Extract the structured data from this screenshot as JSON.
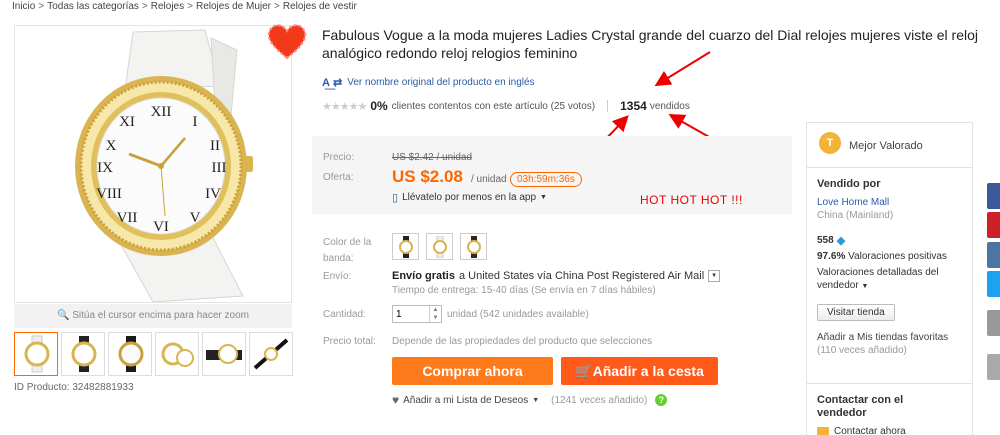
{
  "breadcrumb": [
    "Inicio",
    "Todas las categorías",
    "Relojes",
    "Relojes de Mujer",
    "Relojes de vestir"
  ],
  "zoom_hint": "Sitúa el cursor encima para hacer zoom",
  "product_id": "ID Producto: 32482881933",
  "title": "Fabulous Vogue a la moda mujeres Ladies Crystal grande del cuarzo del Dial relojes mujeres viste el reloj analógico redondo reloj relogios feminino",
  "translate_link": "Ver nombre original del producto en inglés",
  "rating": {
    "percent": "0%",
    "text": "clientes contentos con este artículo (25 votos)",
    "sold_count": "1354",
    "sold_label": "vendidos"
  },
  "price": {
    "label_price": "Precio:",
    "old_price": "US $2.42 / unidad",
    "label_offer": "Oferta:",
    "offer_price": "US $2.08",
    "offer_unit": "/ unidad",
    "timer": "03h:59m:36s",
    "app_link": "Llévatelo por menos en la app"
  },
  "annotation": "HOT HOT HOT !!!",
  "options": {
    "color_label": "Color de la banda:",
    "shipping_label": "Envío:",
    "shipping_free": "Envío gratis",
    "shipping_dest": "a  United States vía China Post Registered Air Mail",
    "delivery": "Tiempo de entrega: 15-40 días (Se envía en 7 días hábiles)",
    "qty_label": "Cantidad:",
    "qty_value": "1",
    "qty_available": "unidad (542 unidades available)",
    "total_label": "Precio total:",
    "total_text": "Depende de las propiedades del producto que selecciones"
  },
  "buttons": {
    "buy_now": "Comprar ahora",
    "add_cart": "Añadir a la cesta"
  },
  "wishlist": {
    "label": "Añadir a mi Lista de Deseos",
    "count": "(1241 veces añadido)"
  },
  "seller": {
    "badge": "Mejor Valorado",
    "sold_by": "Vendido por",
    "store_name": "Love Home Mall",
    "country": "China (Mainland)",
    "score": "558",
    "positive": "97.6%",
    "positive_text": "Valoraciones positivas",
    "detail_ratings": "Valoraciones detalladas del vendedor",
    "visit_store": "Visitar tienda",
    "add_favorites": "Añadir a Mis tiendas favoritas",
    "fav_count": "(110 veces añadido)",
    "contact_title": "Contactar con el vendedor",
    "contact_now": "Contactar ahora"
  },
  "colors": {
    "accent": "#ff6600",
    "buy": "#ff7a1a",
    "cart": "#ff5a1a",
    "link": "#2a5ea8",
    "annotation": "#e00000"
  }
}
